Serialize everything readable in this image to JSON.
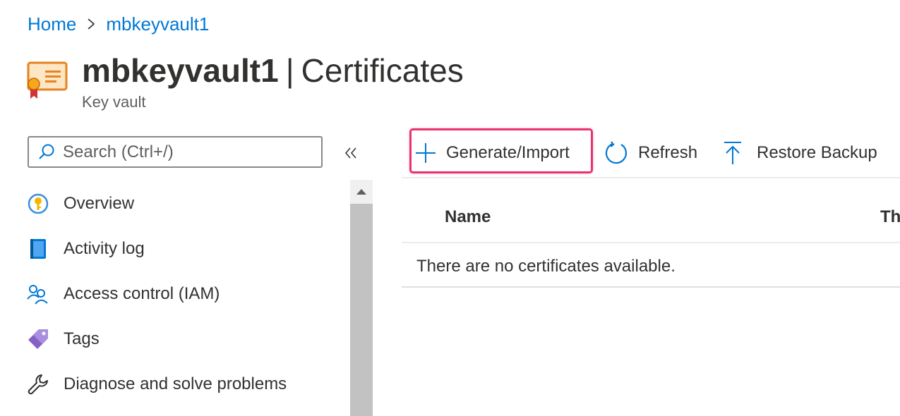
{
  "breadcrumb": {
    "home": "Home",
    "current": "mbkeyvault1"
  },
  "header": {
    "resource_name": "mbkeyvault1",
    "separator": "|",
    "section": "Certificates",
    "subtitle": "Key vault"
  },
  "search": {
    "placeholder": "Search (Ctrl+/)",
    "value": ""
  },
  "sidebar": {
    "collapse_icon": "double-chevron-left-icon",
    "items": [
      {
        "label": "Overview",
        "icon": "key-circle-icon"
      },
      {
        "label": "Activity log",
        "icon": "log-book-icon"
      },
      {
        "label": "Access control (IAM)",
        "icon": "people-icon"
      },
      {
        "label": "Tags",
        "icon": "tag-icon"
      },
      {
        "label": "Diagnose and solve problems",
        "icon": "wrench-icon"
      }
    ]
  },
  "toolbar": {
    "generate_import": "Generate/Import",
    "refresh": "Refresh",
    "restore_backup": "Restore Backup"
  },
  "grid": {
    "columns": [
      "Name",
      "Th"
    ],
    "empty_message": "There are no certificates available."
  },
  "colors": {
    "accent": "#0078d4",
    "highlight": "#e8336f",
    "text": "#323130"
  }
}
